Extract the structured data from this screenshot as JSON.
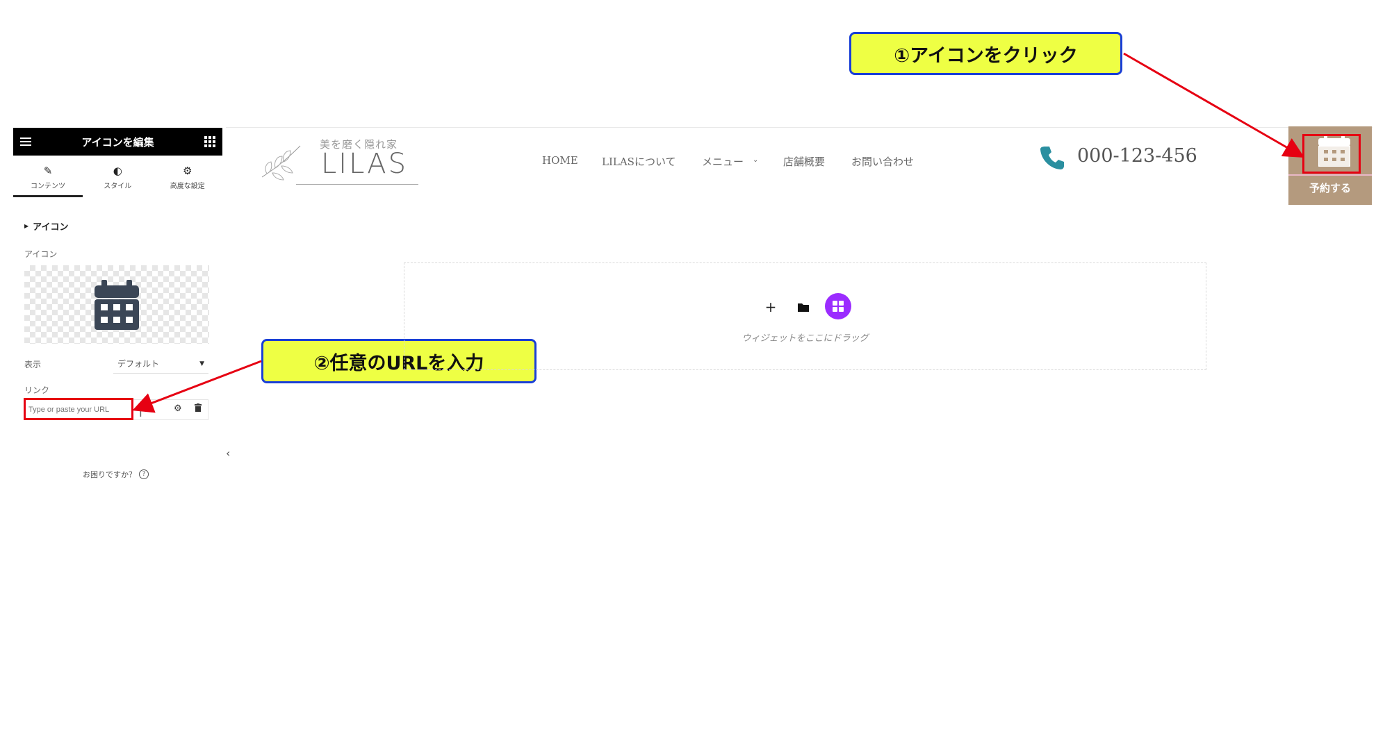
{
  "callouts": {
    "step1": "①アイコンをクリック",
    "step2": "②任意のURLを入力"
  },
  "panel": {
    "title": "アイコンを編集",
    "tabs": [
      {
        "label": "コンテンツ",
        "icon": "pencil-icon"
      },
      {
        "label": "スタイル",
        "icon": "contrast-icon"
      },
      {
        "label": "高度な設定",
        "icon": "gear-icon"
      }
    ],
    "section_title": "アイコン",
    "icon_label": "アイコン",
    "view_label": "表示",
    "view_value": "デフォルト",
    "link_label": "リンク",
    "link_placeholder": "Type or paste your URL",
    "help_text": "お困りですか？",
    "collapse_arrow": "‹"
  },
  "site": {
    "tagline": "美を磨く隠れ家",
    "logo": "LILAS",
    "nav": [
      "HOME",
      "LILASについて",
      "メニュー",
      "店舗概要",
      "お問い合わせ"
    ],
    "phone": "000-123-456",
    "reserve_label": "予約する"
  },
  "canvas": {
    "drop_hint": "ウィジェットをここにドラッグ"
  },
  "colors": {
    "callout_bg": "#eeff44",
    "callout_border": "#1a3fd6",
    "highlight_red": "#e60012",
    "reserve_bg": "#b49a7e",
    "phone_icon": "#2a8fa0",
    "widget_purple": "#9b2cff"
  }
}
